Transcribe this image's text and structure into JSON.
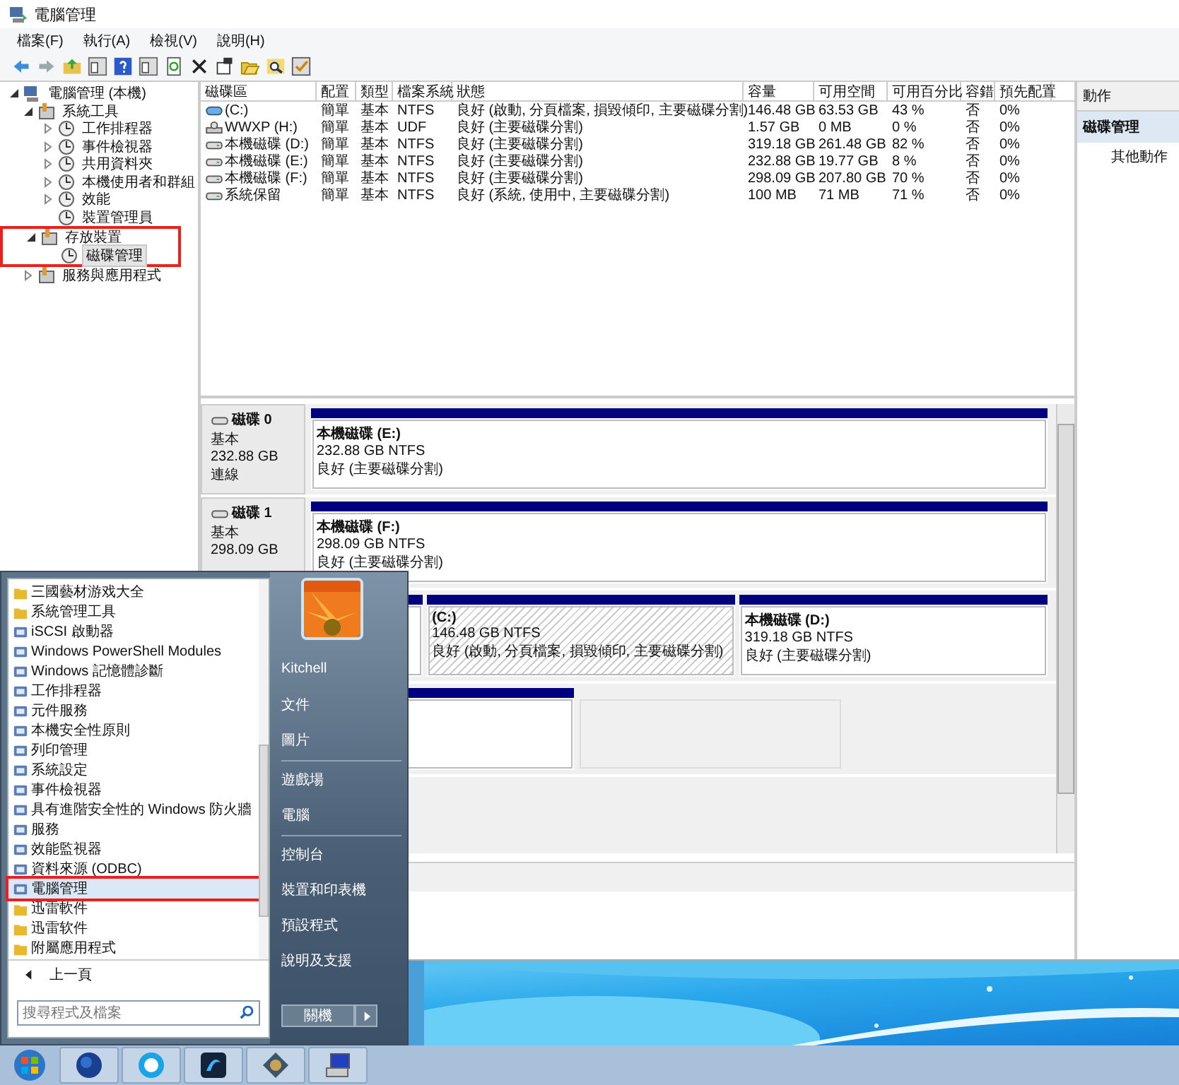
{
  "window": {
    "title": "電腦管理"
  },
  "menu": [
    "檔案(F)",
    "執行(A)",
    "檢視(V)",
    "說明(H)"
  ],
  "tree": [
    {
      "label": "電腦管理 (本機)",
      "expanded": true,
      "selected": false,
      "children": [
        {
          "label": "系統工具",
          "expanded": true,
          "selected": false,
          "highlighted": false,
          "children": [
            {
              "label": "工作排程器",
              "expanded": false,
              "selected": false
            },
            {
              "label": "事件檢視器",
              "expanded": false,
              "selected": false
            },
            {
              "label": "共用資料夾",
              "expanded": false,
              "selected": false
            },
            {
              "label": "本機使用者和群組",
              "expanded": false,
              "selected": false
            },
            {
              "label": "效能",
              "expanded": false,
              "selected": false
            },
            {
              "label": "裝置管理員",
              "selected": false
            }
          ]
        },
        {
          "label": "存放裝置",
          "expanded": true,
          "selected": false,
          "highlighted": true,
          "children": [
            {
              "label": "磁碟管理",
              "selected": true
            }
          ]
        },
        {
          "label": "服務與應用程式",
          "expanded": false,
          "selected": false,
          "highlighted": false
        }
      ]
    }
  ],
  "table": {
    "columns": [
      "磁碟區",
      "配置",
      "類型",
      "檔案系統",
      "狀態",
      "容量",
      "可用空間",
      "可用百分比",
      "容錯",
      "預先配置"
    ],
    "rows": [
      {
        "kind": "system",
        "cells": [
          "(C:)",
          "簡單",
          "基本",
          "NTFS",
          "良好 (啟動, 分頁檔案, 損毀傾印, 主要磁碟分割)",
          "146.48 GB",
          "63.53 GB",
          "43 %",
          "否",
          "0%"
        ]
      },
      {
        "kind": "cd",
        "cells": [
          "WWXP (H:)",
          "簡單",
          "基本",
          "UDF",
          "良好 (主要磁碟分割)",
          "1.57 GB",
          "0 MB",
          "0 %",
          "否",
          "0%"
        ]
      },
      {
        "kind": "disk",
        "cells": [
          "本機磁碟 (D:)",
          "簡單",
          "基本",
          "NTFS",
          "良好 (主要磁碟分割)",
          "319.18 GB",
          "261.48 GB",
          "82 %",
          "否",
          "0%"
        ]
      },
      {
        "kind": "disk",
        "cells": [
          "本機磁碟 (E:)",
          "簡單",
          "基本",
          "NTFS",
          "良好 (主要磁碟分割)",
          "232.88 GB",
          "19.77 GB",
          "8 %",
          "否",
          "0%"
        ]
      },
      {
        "kind": "disk",
        "cells": [
          "本機磁碟 (F:)",
          "簡單",
          "基本",
          "NTFS",
          "良好 (主要磁碟分割)",
          "298.09 GB",
          "207.80 GB",
          "70 %",
          "否",
          "0%"
        ]
      },
      {
        "kind": "disk",
        "cells": [
          "系統保留",
          "簡單",
          "基本",
          "NTFS",
          "良好 (系統, 使用中, 主要磁碟分割)",
          "100 MB",
          "71 MB",
          "71 %",
          "否",
          "0%"
        ]
      }
    ]
  },
  "disks": [
    {
      "name": "磁碟 0",
      "type": "基本",
      "size": "232.88 GB",
      "status": "連線",
      "partitions": [
        {
          "kind": "primary",
          "label": "本機磁碟  (E:)",
          "size": "232.88 GB NTFS",
          "status": "良好 (主要磁碟分割)"
        }
      ]
    },
    {
      "name": "磁碟 1",
      "type": "基本",
      "size": "298.09 GB",
      "partitions": [
        {
          "kind": "primary",
          "label": "本機磁碟  (F:)",
          "size": "298.09 GB NTFS",
          "status": "良好 (主要磁碟分割)"
        }
      ]
    },
    {
      "partitions": [
        {
          "kind": "primary"
        },
        {
          "kind": "active",
          "label": "(C:)",
          "size": "146.48 GB NTFS",
          "status": "良好 (啟動, 分頁檔案, 損毀傾印, 主要磁碟分割)"
        },
        {
          "kind": "primary",
          "label": "本機磁碟  (D:)",
          "size": "319.18 GB NTFS",
          "status": "良好 (主要磁碟分割)"
        }
      ]
    },
    {
      "partitions": [
        {
          "kind": "primary"
        },
        {
          "kind": "unallocated"
        }
      ]
    }
  ],
  "actions": {
    "title": "動作",
    "section": "磁碟管理",
    "items": [
      "其他動作"
    ]
  },
  "start_menu": {
    "programs": [
      {
        "kind": "folder",
        "label": "三國藝材游戏大全",
        "selected": false,
        "highlighted": false
      },
      {
        "kind": "folder",
        "label": "系統管理工具",
        "selected": false,
        "highlighted": false
      },
      {
        "kind": "program",
        "label": "iSCSI 啟動器",
        "selected": false,
        "highlighted": false
      },
      {
        "kind": "program",
        "label": "Windows PowerShell Modules",
        "selected": false,
        "highlighted": false
      },
      {
        "kind": "program",
        "label": "Windows 記憶體診斷",
        "selected": false,
        "highlighted": false
      },
      {
        "kind": "program",
        "label": "工作排程器",
        "selected": false,
        "highlighted": false
      },
      {
        "kind": "program",
        "label": "元件服務",
        "selected": false,
        "highlighted": false
      },
      {
        "kind": "program",
        "label": "本機安全性原則",
        "selected": false,
        "highlighted": false
      },
      {
        "kind": "program",
        "label": "列印管理",
        "selected": false,
        "highlighted": false
      },
      {
        "kind": "program",
        "label": "系統設定",
        "selected": false,
        "highlighted": false
      },
      {
        "kind": "program",
        "label": "事件檢視器",
        "selected": false,
        "highlighted": false
      },
      {
        "kind": "program",
        "label": "具有進階安全性的 Windows 防火牆",
        "selected": false,
        "highlighted": false
      },
      {
        "kind": "program",
        "label": "服務",
        "selected": false,
        "highlighted": false
      },
      {
        "kind": "program",
        "label": "效能監視器",
        "selected": false,
        "highlighted": false
      },
      {
        "kind": "program",
        "label": "資料來源 (ODBC)",
        "selected": false,
        "highlighted": false
      },
      {
        "kind": "program",
        "label": "電腦管理",
        "selected": true,
        "highlighted": true
      },
      {
        "kind": "folder",
        "label": "迅雷軟件",
        "selected": false,
        "highlighted": false
      },
      {
        "kind": "folder",
        "label": "迅雷软件",
        "selected": false,
        "highlighted": false
      },
      {
        "kind": "folder",
        "label": "附屬應用程式",
        "selected": false,
        "highlighted": false
      }
    ],
    "back": "上一頁",
    "search": {
      "placeholder": "搜尋程式及檔案"
    },
    "places": [
      {
        "label": "Kitchell",
        "separator_before": false
      },
      {
        "label": "文件",
        "separator_before": false
      },
      {
        "label": "圖片",
        "separator_before": false
      },
      {
        "label": "遊戲場",
        "separator_before": true
      },
      {
        "label": "電腦",
        "separator_before": false
      },
      {
        "label": "控制台",
        "separator_before": true
      },
      {
        "label": "裝置和印表機",
        "separator_before": false
      },
      {
        "label": "預設程式",
        "separator_before": false
      },
      {
        "label": "說明及支援",
        "separator_before": false
      }
    ],
    "shutdown": "關機"
  }
}
